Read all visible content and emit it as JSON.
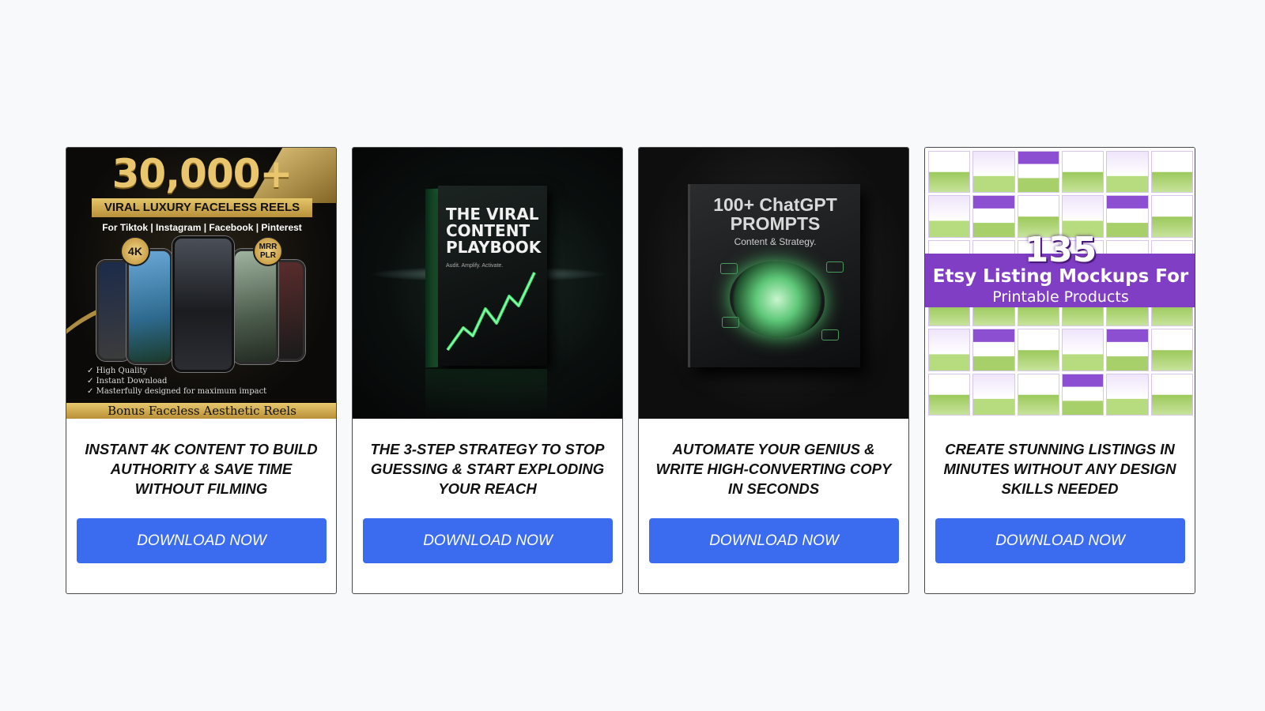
{
  "products": [
    {
      "id": "reels",
      "caption": "INSTANT 4K CONTENT TO BUILD AUTHORITY & SAVE TIME WITHOUT FILMING",
      "button": "DOWNLOAD NOW",
      "cover": {
        "headline": "30,000+",
        "ribbon": "VIRAL LUXURY FACELESS REELS",
        "platforms": "For Tiktok | Instagram | Facebook | Pinterest",
        "badge_left": "4K",
        "badge_right": "MRR PLR",
        "bullets": [
          "High Quality",
          "Instant Download",
          "Masterfully designed for maximum impact"
        ],
        "footer": "Bonus Faceless Aesthetic Reels"
      }
    },
    {
      "id": "playbook",
      "caption": "THE 3-STEP STRATEGY TO STOP GUESSING & START EXPLODING YOUR REACH",
      "button": "DOWNLOAD NOW",
      "cover": {
        "title": "THE VIRAL CONTENT PLAYBOOK",
        "subtitle": "Audit. Amplify. Activate."
      }
    },
    {
      "id": "prompts",
      "caption": "AUTOMATE YOUR GENIUS & WRITE HIGH-CONVERTING COPY IN SECONDS",
      "button": "DOWNLOAD NOW",
      "cover": {
        "title": "100+ ChatGPT PROMPTS",
        "subtitle": "Content & Strategy."
      }
    },
    {
      "id": "etsy",
      "caption": "CREATE STUNNING LISTINGS IN MINUTES WITHOUT ANY DESIGN SKILLS NEEDED",
      "button": "DOWNLOAD NOW",
      "cover": {
        "number": "135",
        "line1": "Etsy Listing Mockups For",
        "line2": "Printable Products"
      }
    }
  ],
  "colors": {
    "button": "#3b6cf0",
    "page_bg": "#f8f9fb",
    "gold": "#e9c66e",
    "etsy_purple": "#7f3ec4",
    "neon_green": "#3ddc6a"
  },
  "icons": [
    "check-icon",
    "brain-icon",
    "trend-arrow-icon"
  ]
}
